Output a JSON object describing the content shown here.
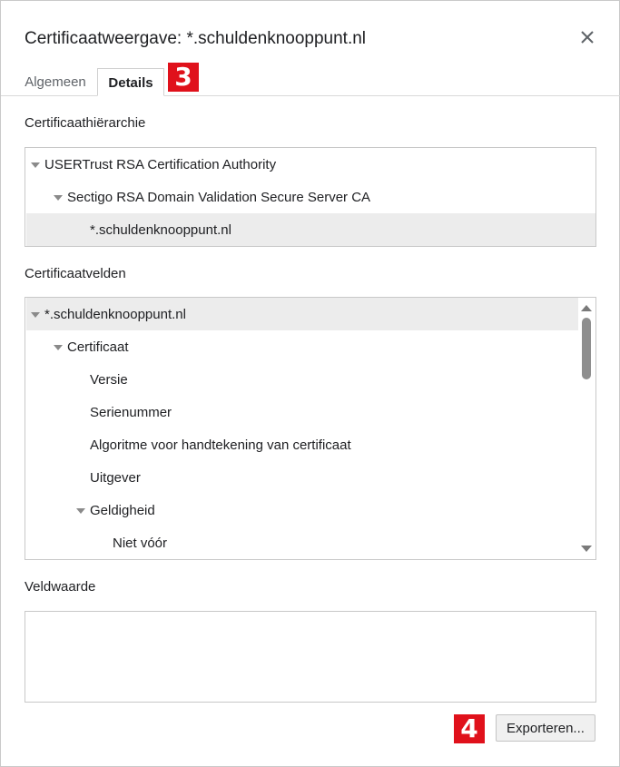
{
  "dialog": {
    "title": "Certificaatweergave: *.schuldenknooppunt.nl",
    "close_icon": "close-icon"
  },
  "tabs": [
    {
      "label": "Algemeen",
      "active": false
    },
    {
      "label": "Details",
      "active": true
    }
  ],
  "annotations": {
    "badge_3": "3",
    "badge_4": "4",
    "color": "#e0111b"
  },
  "hierarchy": {
    "label": "Certificaathiërarchie",
    "items": [
      {
        "label": "USERTrust RSA Certification Authority",
        "level": 0,
        "expanded": true,
        "selected": false
      },
      {
        "label": "Sectigo RSA Domain Validation Secure Server CA",
        "level": 1,
        "expanded": true,
        "selected": false
      },
      {
        "label": "*.schuldenknooppunt.nl",
        "level": 2,
        "expanded": false,
        "selected": true
      }
    ]
  },
  "fields": {
    "label": "Certificaatvelden",
    "items": [
      {
        "label": "*.schuldenknooppunt.nl",
        "level": 0,
        "expanded": true,
        "selected": true
      },
      {
        "label": "Certificaat",
        "level": 1,
        "expanded": true,
        "selected": false
      },
      {
        "label": "Versie",
        "level": 2,
        "expanded": false,
        "selected": false
      },
      {
        "label": "Serienummer",
        "level": 2,
        "expanded": false,
        "selected": false
      },
      {
        "label": "Algoritme voor handtekening van certificaat",
        "level": 2,
        "expanded": false,
        "selected": false
      },
      {
        "label": "Uitgever",
        "level": 2,
        "expanded": false,
        "selected": false
      },
      {
        "label": "Geldigheid",
        "level": 2,
        "expanded": true,
        "selected": false
      },
      {
        "label": "Niet vóór",
        "level": 3,
        "expanded": false,
        "selected": false
      }
    ]
  },
  "value": {
    "label": "Veldwaarde",
    "content": ""
  },
  "buttons": {
    "export_label": "Exporteren..."
  }
}
